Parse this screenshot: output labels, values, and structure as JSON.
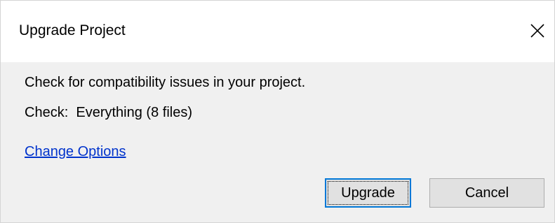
{
  "window": {
    "title": "Upgrade Project",
    "close_icon": "close-icon"
  },
  "body": {
    "message": "Check for compatibility issues in your project.",
    "check_label": "Check:",
    "check_value": "Everything (8 files)",
    "change_options_link": "Change Options"
  },
  "buttons": {
    "upgrade_label": "Upgrade",
    "cancel_label": "Cancel"
  },
  "colors": {
    "link": "#0033cc",
    "content_background": "#f0f0f0",
    "default_button_border": "#0078d7"
  }
}
